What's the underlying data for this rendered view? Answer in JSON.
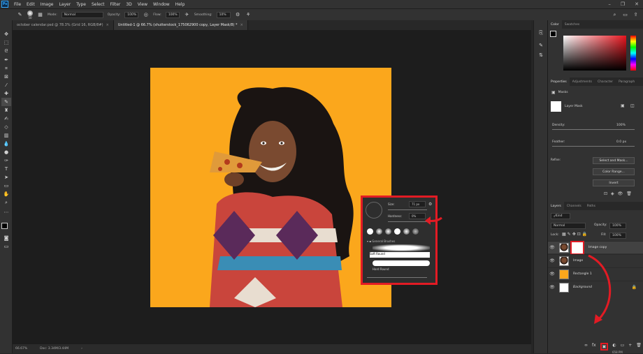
{
  "app": {
    "logo": "Ps"
  },
  "menu": [
    "File",
    "Edit",
    "Image",
    "Layer",
    "Type",
    "Select",
    "Filter",
    "3D",
    "View",
    "Window",
    "Help"
  ],
  "window_controls": [
    "–",
    "❐",
    "✕"
  ],
  "options": {
    "brush_size": "50",
    "mode_label": "Mode:",
    "mode_value": "Normal",
    "opacity_label": "Opacity:",
    "opacity_value": "100%",
    "flow_label": "Flow:",
    "flow_value": "100%",
    "smoothing_label": "Smoothing:",
    "smoothing_value": "10%"
  },
  "tabs": [
    {
      "label": "october calendar.psd @ 78.3% (Grid 16, RGB/8#)",
      "close": "×"
    },
    {
      "label": "Untitled-1 @ 66.7% (shutterstock_175062900 copy, Layer Mask/8) *",
      "close": "×"
    }
  ],
  "status": {
    "zoom": "66.67%",
    "doc": "Doc: 3.34M/3.44M",
    "arrow": "›"
  },
  "color_panel": {
    "tabs": [
      "Color",
      "Swatches"
    ]
  },
  "properties": {
    "tabs": [
      "Properties",
      "Adjustments",
      "Character",
      "Paragraph"
    ],
    "masks_label": "Masks",
    "layer_mask_label": "Layer Mask",
    "density_label": "Density:",
    "density_value": "100%",
    "feather_label": "Feather:",
    "feather_value": "0.0 px",
    "refine_label": "Refine:",
    "select_mask_btn": "Select and Mask...",
    "color_range_btn": "Color Range...",
    "invert_btn": "Invert"
  },
  "layers": {
    "tabs": [
      "Layers",
      "Channels",
      "Paths"
    ],
    "kind_label": "Kind",
    "blend_mode": "Normal",
    "opacity_label": "Opacity:",
    "opacity_value": "100%",
    "lock_label": "Lock:",
    "fill_label": "Fill:",
    "fill_value": "100%",
    "items": [
      {
        "name": "Image copy",
        "selected": true
      },
      {
        "name": "Image"
      },
      {
        "name": "Rectangle 1"
      },
      {
        "name": "Background"
      }
    ],
    "footer_icons": [
      "∞",
      "fx",
      "▣",
      "◐",
      "▭",
      "+",
      "🗑"
    ]
  },
  "brush_popup": {
    "size_label": "Size:",
    "size_value": "71 px",
    "hardness_label": "Hardness:",
    "hardness_value": "0%",
    "folder_label": "General Brushes",
    "items": [
      "Soft Round",
      "Hard Round"
    ]
  },
  "bottom_text": "658 PM",
  "colors": {
    "artboard": "#fba71c",
    "annotation": "#e21b24"
  }
}
